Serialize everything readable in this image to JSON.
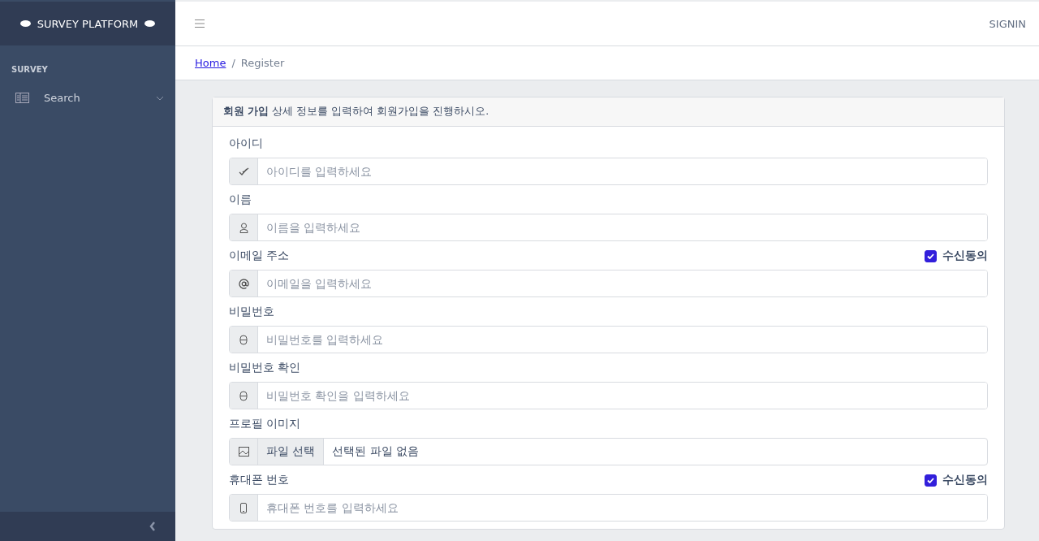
{
  "sidebar": {
    "brand": "SURVEY PLATFORM",
    "section": "SURVEY",
    "items": [
      {
        "label": "Search",
        "expanded": false
      }
    ]
  },
  "topbar": {
    "signin": "SIGNIN"
  },
  "breadcrumb": {
    "separator": "/",
    "items": [
      {
        "label": "Home",
        "kind": "link"
      },
      {
        "label": "Register",
        "kind": "current"
      }
    ]
  },
  "form": {
    "header": "**회원 가입** 상세 정보를 입력하여 회원가입을 진행하시오.",
    "fields": [
      {
        "label": "아이디",
        "kind": "text",
        "placeholder": "아이디를 입력하세요"
      },
      {
        "label": "이름",
        "kind": "text",
        "placeholder": "이름을 입력하세요"
      },
      {
        "label": "이메일 주소",
        "kind": "text",
        "placeholder": "이메일을 입력하세요",
        "consent": {
          "label": "수신동의",
          "checked": true
        }
      },
      {
        "label": "비밀번호",
        "kind": "text",
        "placeholder": "비밀번호를 입력하세요"
      },
      {
        "label": "비밀번호 확인",
        "kind": "text",
        "placeholder": "비밀번호 확인을 입력하세요"
      },
      {
        "label": "프로필 이미지",
        "kind": "file",
        "button": "파일 선택",
        "value": "선택된 파일 없음"
      },
      {
        "label": "휴대폰 번호",
        "kind": "text",
        "placeholder": "휴대폰 번호를 입력하세요",
        "consent": {
          "label": "수신동의",
          "checked": true
        }
      }
    ]
  }
}
